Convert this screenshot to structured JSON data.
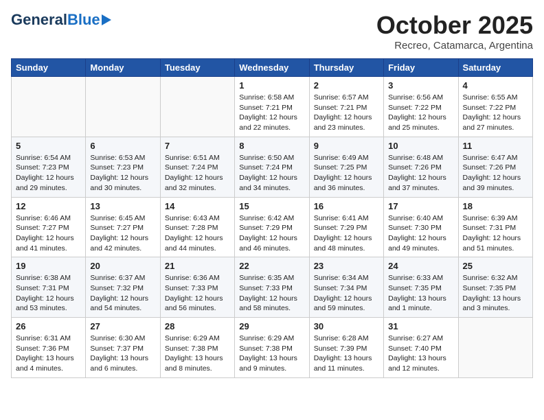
{
  "header": {
    "logo_general": "General",
    "logo_blue": "Blue",
    "month_title": "October 2025",
    "subtitle": "Recreo, Catamarca, Argentina"
  },
  "days_of_week": [
    "Sunday",
    "Monday",
    "Tuesday",
    "Wednesday",
    "Thursday",
    "Friday",
    "Saturday"
  ],
  "weeks": [
    [
      {
        "day": "",
        "info": ""
      },
      {
        "day": "",
        "info": ""
      },
      {
        "day": "",
        "info": ""
      },
      {
        "day": "1",
        "info": "Sunrise: 6:58 AM\nSunset: 7:21 PM\nDaylight: 12 hours\nand 22 minutes."
      },
      {
        "day": "2",
        "info": "Sunrise: 6:57 AM\nSunset: 7:21 PM\nDaylight: 12 hours\nand 23 minutes."
      },
      {
        "day": "3",
        "info": "Sunrise: 6:56 AM\nSunset: 7:22 PM\nDaylight: 12 hours\nand 25 minutes."
      },
      {
        "day": "4",
        "info": "Sunrise: 6:55 AM\nSunset: 7:22 PM\nDaylight: 12 hours\nand 27 minutes."
      }
    ],
    [
      {
        "day": "5",
        "info": "Sunrise: 6:54 AM\nSunset: 7:23 PM\nDaylight: 12 hours\nand 29 minutes."
      },
      {
        "day": "6",
        "info": "Sunrise: 6:53 AM\nSunset: 7:23 PM\nDaylight: 12 hours\nand 30 minutes."
      },
      {
        "day": "7",
        "info": "Sunrise: 6:51 AM\nSunset: 7:24 PM\nDaylight: 12 hours\nand 32 minutes."
      },
      {
        "day": "8",
        "info": "Sunrise: 6:50 AM\nSunset: 7:24 PM\nDaylight: 12 hours\nand 34 minutes."
      },
      {
        "day": "9",
        "info": "Sunrise: 6:49 AM\nSunset: 7:25 PM\nDaylight: 12 hours\nand 36 minutes."
      },
      {
        "day": "10",
        "info": "Sunrise: 6:48 AM\nSunset: 7:26 PM\nDaylight: 12 hours\nand 37 minutes."
      },
      {
        "day": "11",
        "info": "Sunrise: 6:47 AM\nSunset: 7:26 PM\nDaylight: 12 hours\nand 39 minutes."
      }
    ],
    [
      {
        "day": "12",
        "info": "Sunrise: 6:46 AM\nSunset: 7:27 PM\nDaylight: 12 hours\nand 41 minutes."
      },
      {
        "day": "13",
        "info": "Sunrise: 6:45 AM\nSunset: 7:27 PM\nDaylight: 12 hours\nand 42 minutes."
      },
      {
        "day": "14",
        "info": "Sunrise: 6:43 AM\nSunset: 7:28 PM\nDaylight: 12 hours\nand 44 minutes."
      },
      {
        "day": "15",
        "info": "Sunrise: 6:42 AM\nSunset: 7:29 PM\nDaylight: 12 hours\nand 46 minutes."
      },
      {
        "day": "16",
        "info": "Sunrise: 6:41 AM\nSunset: 7:29 PM\nDaylight: 12 hours\nand 48 minutes."
      },
      {
        "day": "17",
        "info": "Sunrise: 6:40 AM\nSunset: 7:30 PM\nDaylight: 12 hours\nand 49 minutes."
      },
      {
        "day": "18",
        "info": "Sunrise: 6:39 AM\nSunset: 7:31 PM\nDaylight: 12 hours\nand 51 minutes."
      }
    ],
    [
      {
        "day": "19",
        "info": "Sunrise: 6:38 AM\nSunset: 7:31 PM\nDaylight: 12 hours\nand 53 minutes."
      },
      {
        "day": "20",
        "info": "Sunrise: 6:37 AM\nSunset: 7:32 PM\nDaylight: 12 hours\nand 54 minutes."
      },
      {
        "day": "21",
        "info": "Sunrise: 6:36 AM\nSunset: 7:33 PM\nDaylight: 12 hours\nand 56 minutes."
      },
      {
        "day": "22",
        "info": "Sunrise: 6:35 AM\nSunset: 7:33 PM\nDaylight: 12 hours\nand 58 minutes."
      },
      {
        "day": "23",
        "info": "Sunrise: 6:34 AM\nSunset: 7:34 PM\nDaylight: 12 hours\nand 59 minutes."
      },
      {
        "day": "24",
        "info": "Sunrise: 6:33 AM\nSunset: 7:35 PM\nDaylight: 13 hours\nand 1 minute."
      },
      {
        "day": "25",
        "info": "Sunrise: 6:32 AM\nSunset: 7:35 PM\nDaylight: 13 hours\nand 3 minutes."
      }
    ],
    [
      {
        "day": "26",
        "info": "Sunrise: 6:31 AM\nSunset: 7:36 PM\nDaylight: 13 hours\nand 4 minutes."
      },
      {
        "day": "27",
        "info": "Sunrise: 6:30 AM\nSunset: 7:37 PM\nDaylight: 13 hours\nand 6 minutes."
      },
      {
        "day": "28",
        "info": "Sunrise: 6:29 AM\nSunset: 7:38 PM\nDaylight: 13 hours\nand 8 minutes."
      },
      {
        "day": "29",
        "info": "Sunrise: 6:29 AM\nSunset: 7:38 PM\nDaylight: 13 hours\nand 9 minutes."
      },
      {
        "day": "30",
        "info": "Sunrise: 6:28 AM\nSunset: 7:39 PM\nDaylight: 13 hours\nand 11 minutes."
      },
      {
        "day": "31",
        "info": "Sunrise: 6:27 AM\nSunset: 7:40 PM\nDaylight: 13 hours\nand 12 minutes."
      },
      {
        "day": "",
        "info": ""
      }
    ]
  ]
}
